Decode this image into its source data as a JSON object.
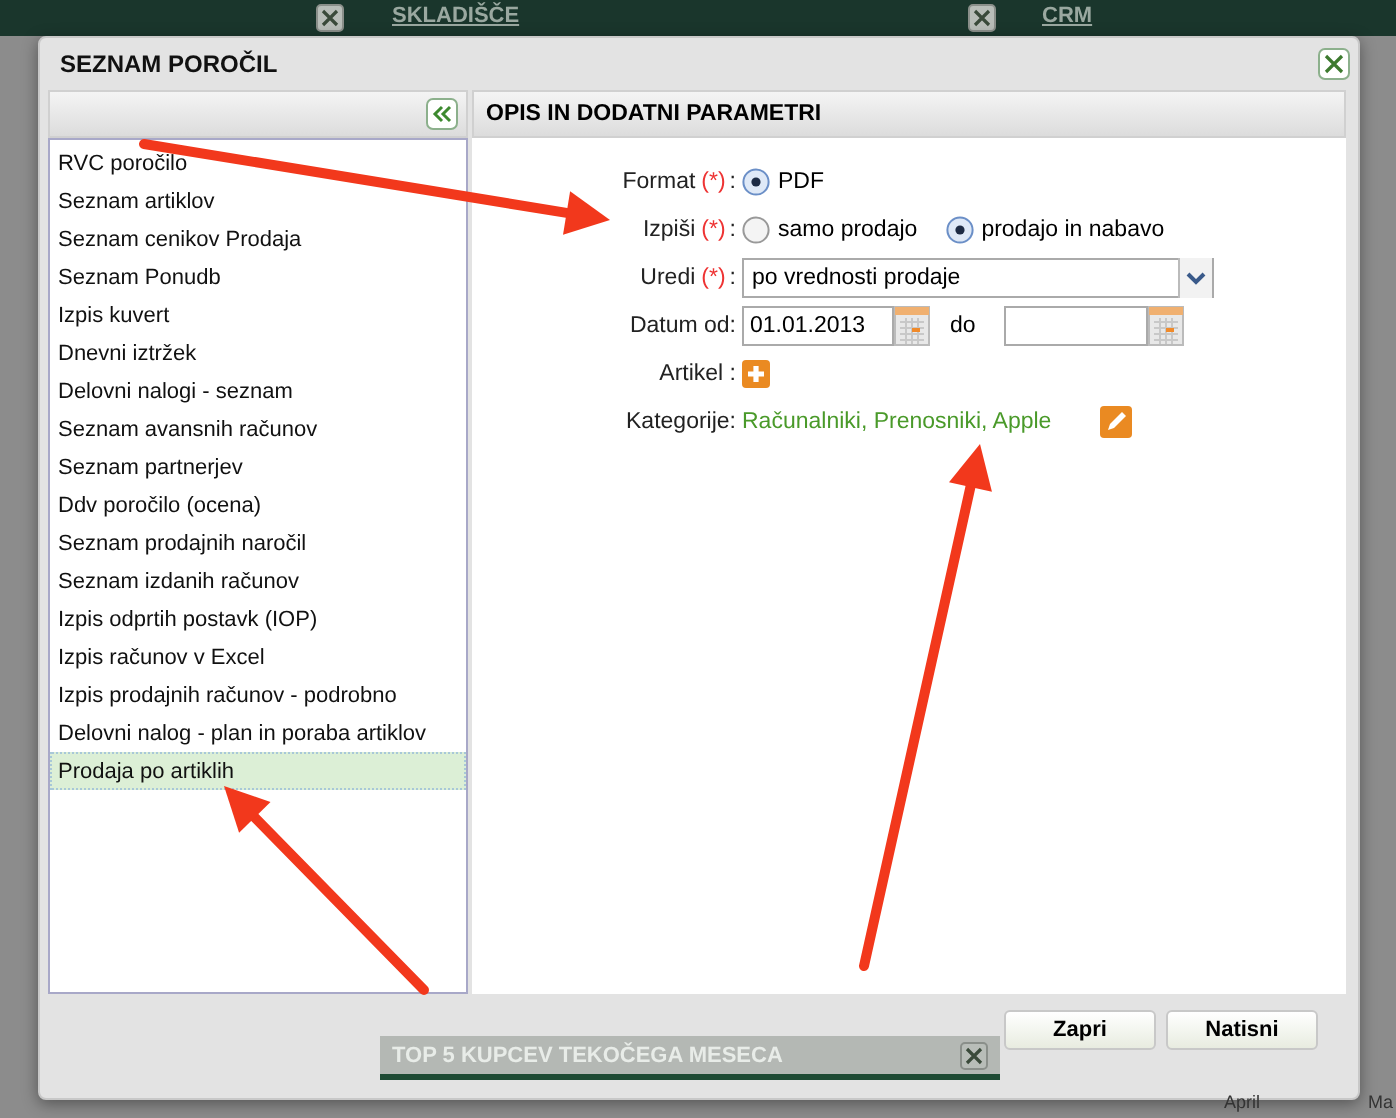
{
  "background": {
    "tabs": [
      {
        "title": "SKLADIŠČE"
      },
      {
        "title": "CRM"
      }
    ],
    "panel_title": "TOP 5 KUPCEV TEKOČEGA MESECA",
    "axis_labels": [
      "April",
      "Ma"
    ]
  },
  "dialog": {
    "title": "SEZNAM POROČIL",
    "report_list": [
      {
        "label": "RVC poročilo",
        "selected": false
      },
      {
        "label": "Seznam artiklov",
        "selected": false
      },
      {
        "label": "Seznam cenikov Prodaja",
        "selected": false
      },
      {
        "label": "Seznam Ponudb",
        "selected": false
      },
      {
        "label": "Izpis kuvert",
        "selected": false
      },
      {
        "label": "Dnevni iztržek",
        "selected": false
      },
      {
        "label": "Delovni nalogi - seznam",
        "selected": false
      },
      {
        "label": "Seznam avansnih računov",
        "selected": false
      },
      {
        "label": "Seznam partnerjev",
        "selected": false
      },
      {
        "label": "Ddv poročilo (ocena)",
        "selected": false
      },
      {
        "label": "Seznam prodajnih naročil",
        "selected": false
      },
      {
        "label": "Seznam izdanih računov",
        "selected": false
      },
      {
        "label": "Izpis odprtih postavk (IOP)",
        "selected": false
      },
      {
        "label": "Izpis računov v Excel",
        "selected": false
      },
      {
        "label": "Izpis prodajnih računov - podrobno",
        "selected": false
      },
      {
        "label": "Delovni nalog - plan in poraba artiklov",
        "selected": false
      },
      {
        "label": "Prodaja po artiklih",
        "selected": true
      }
    ],
    "panel_title": "OPIS IN DODATNI PARAMETRI",
    "fields": [
      {
        "kind": "radio",
        "label": "Format",
        "required": "(*)",
        "colon": ":",
        "options": [
          {
            "label": "PDF",
            "selected": true
          }
        ]
      },
      {
        "kind": "radio",
        "label": "Izpiši",
        "required": "(*)",
        "colon": ":",
        "options": [
          {
            "label": "samo prodajo",
            "selected": false
          },
          {
            "label": "prodajo in nabavo",
            "selected": true
          }
        ]
      },
      {
        "kind": "select",
        "label": "Uredi",
        "required": "(*)",
        "colon": ":",
        "value": "po vrednosti prodaje"
      },
      {
        "kind": "daterange",
        "label": "Datum od:",
        "value": "01.01.2013",
        "to_label": "do"
      },
      {
        "kind": "add",
        "label": "Artikel :"
      },
      {
        "kind": "link",
        "label": "Kategorije:",
        "value": "Računalniki, Prenosniki, Apple"
      }
    ],
    "buttons": [
      "Zapri",
      "Natisni"
    ]
  }
}
